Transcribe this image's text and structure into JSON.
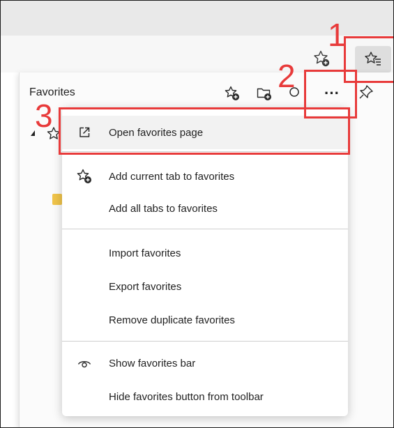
{
  "favorites_pane": {
    "title": "Favorites"
  },
  "menu": {
    "items": [
      {
        "label": "Open favorites page",
        "icon": "open-external-icon"
      },
      {
        "label": "Add current tab to favorites",
        "icon": "star-add-icon"
      },
      {
        "label": "Add all tabs to favorites",
        "icon": ""
      },
      {
        "label": "Import favorites",
        "icon": ""
      },
      {
        "label": "Export favorites",
        "icon": ""
      },
      {
        "label": "Remove duplicate favorites",
        "icon": ""
      },
      {
        "label": "Show favorites bar",
        "icon": "eye-icon"
      },
      {
        "label": "Hide favorites button from toolbar",
        "icon": ""
      }
    ]
  },
  "annotations": {
    "step1": "1",
    "step2": "2",
    "step3": "3",
    "color": "#e83a3a"
  },
  "icons": {
    "more": "···"
  }
}
